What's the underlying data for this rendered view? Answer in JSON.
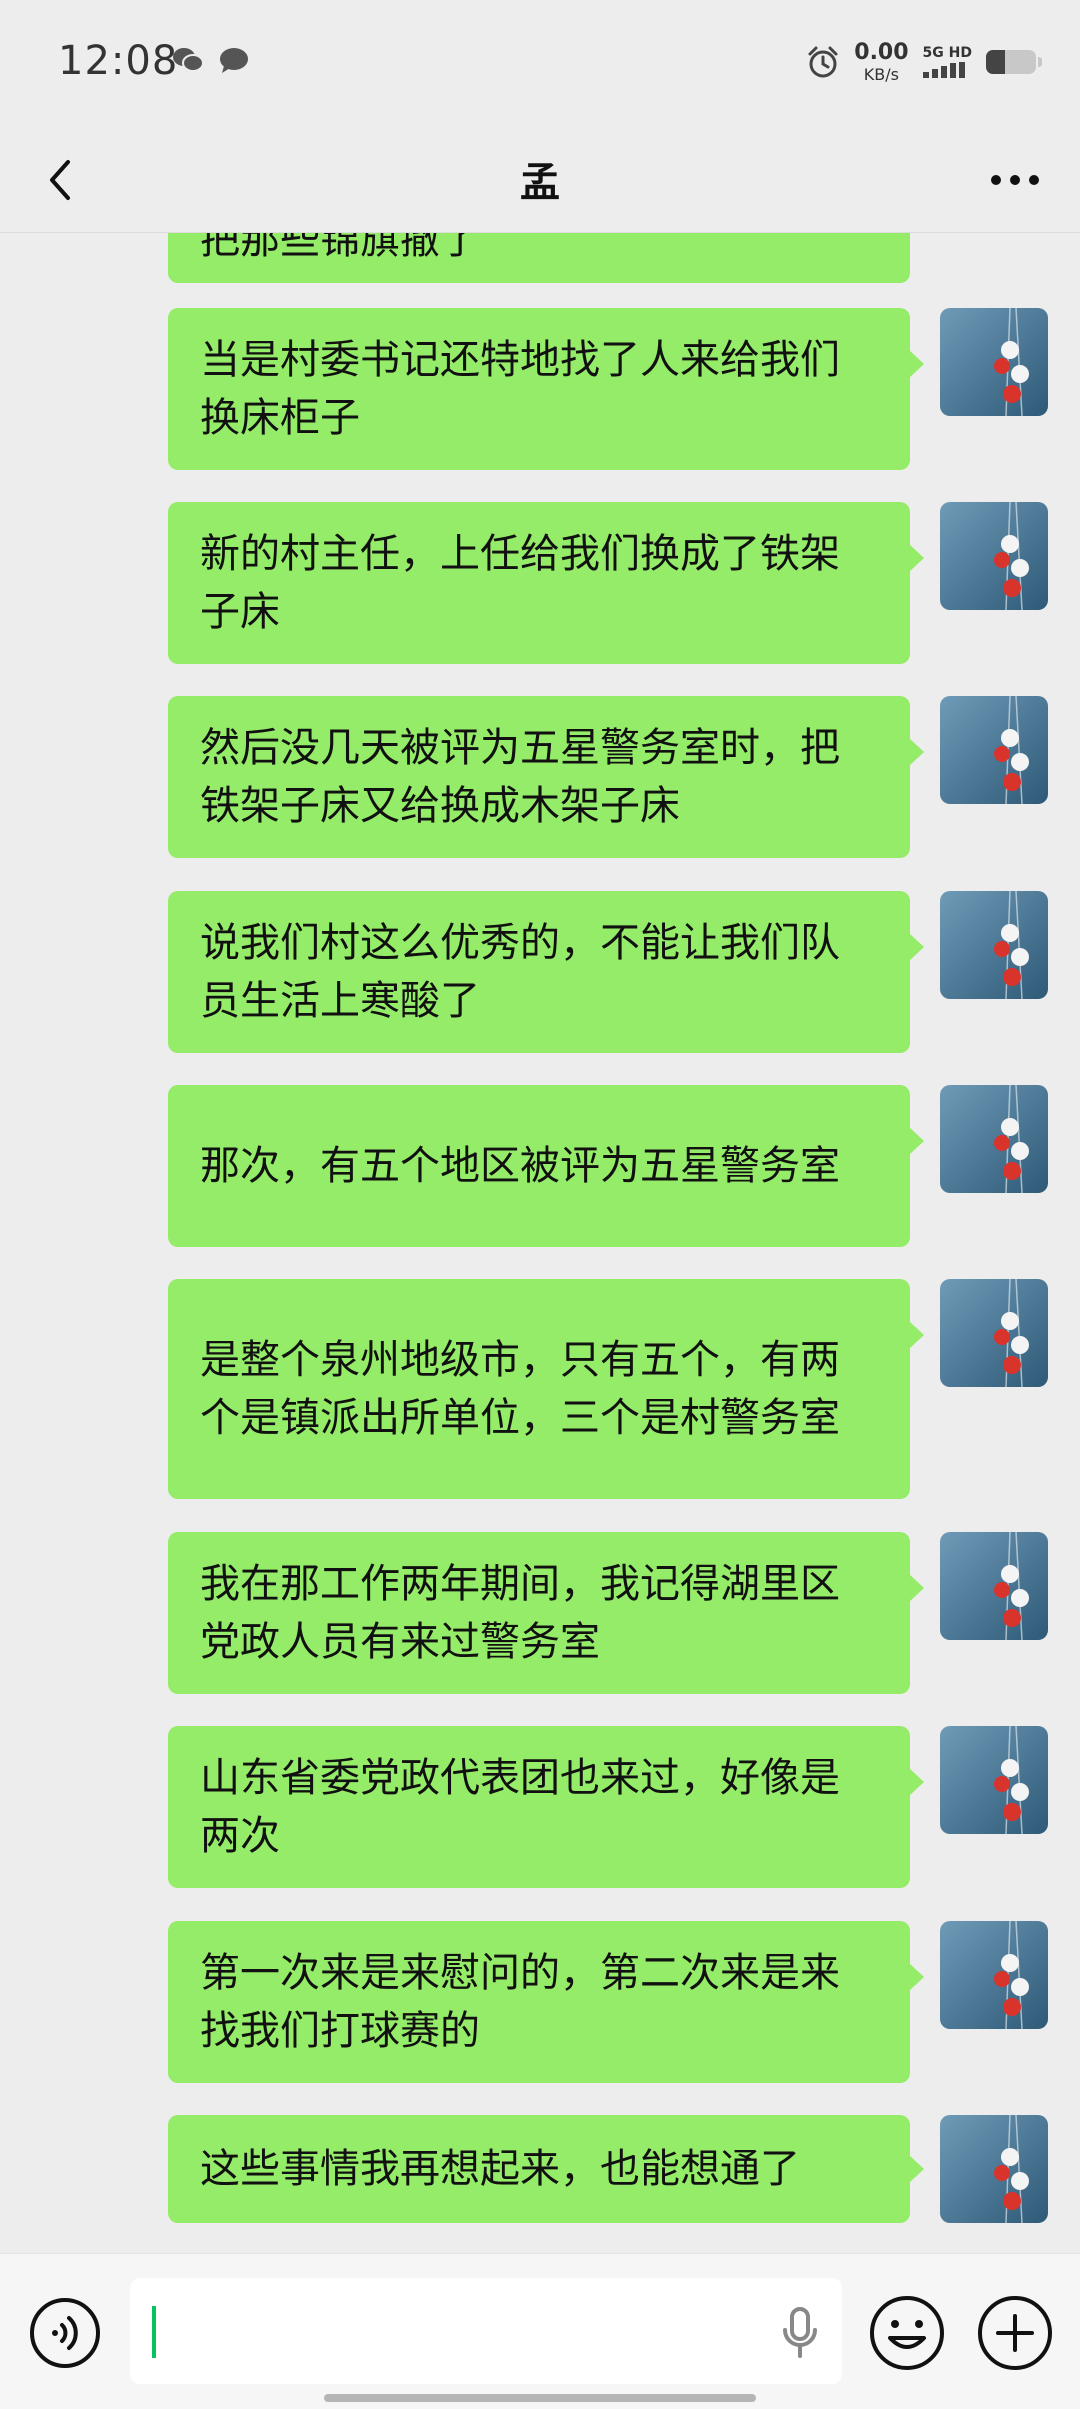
{
  "status_bar": {
    "time": "12:08",
    "net_speed_value": "0.00",
    "net_speed_unit": "KB/s",
    "net_type": "5G HD",
    "battery_level_fraction": 0.38
  },
  "nav": {
    "title": "孟",
    "back_icon": "chevron-left-icon",
    "more_icon": "more-horizontal-icon"
  },
  "messages": [
    {
      "text": "把那些锦旗撤了"
    },
    {
      "text": "当是村委书记还特地找了人来给我们换床柜子"
    },
    {
      "text": "新的村主任，上任给我们换成了铁架子床"
    },
    {
      "text": "然后没几天被评为五星警务室时，把铁架子床又给换成木架子床"
    },
    {
      "text": "说我们村这么优秀的，不能让我们队员生活上寒酸了"
    },
    {
      "text": "那次，有五个地区被评为五星警务室"
    },
    {
      "text": "是整个泉州地级市，只有五个，有两个是镇派出所单位，三个是村警务室"
    },
    {
      "text": "我在那工作两年期间，我记得湖里区党政人员有来过警务室"
    },
    {
      "text": "山东省委党政代表团也来过，好像是两次"
    },
    {
      "text": "第一次来是来慰问的，第二次来是来找我们打球赛的"
    },
    {
      "text": "这些事情我再想起来，也能想通了"
    }
  ],
  "input_bar": {
    "voice_icon": "voice-mode-icon",
    "mic_icon": "microphone-icon",
    "emoji_icon": "emoji-icon",
    "plus_icon": "plus-circle-icon"
  },
  "colors": {
    "bubble": "#95ec69",
    "background": "#ededed",
    "caret": "#07c160"
  }
}
